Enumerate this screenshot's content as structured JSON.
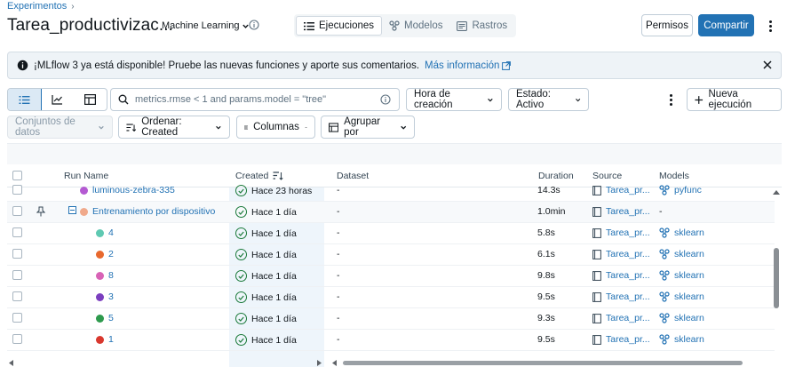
{
  "breadcrumb": {
    "root": "Experimentos",
    "sep": "›"
  },
  "experiment": {
    "title": "Tarea_productivizac...",
    "type_label": "Machine Learning"
  },
  "view_tabs": [
    {
      "label": "Ejecuciones",
      "icon": "list-icon",
      "active": true
    },
    {
      "label": "Modelos",
      "icon": "models-icon",
      "active": false
    },
    {
      "label": "Rastros",
      "icon": "traces-icon",
      "active": false
    }
  ],
  "header_buttons": {
    "permissions": "Permisos",
    "share": "Compartir"
  },
  "banner": {
    "text": "¡MLflow 3 ya está disponible! Pruebe las nuevas funciones y aporte sus comentarios.",
    "link": "Más información"
  },
  "search": {
    "placeholder": "metrics.rmse < 1 and params.model = \"tree\""
  },
  "filters": {
    "sort_time": "Hora de creación",
    "state": "Estado: Activo",
    "new_run": "Nueva ejecución"
  },
  "toolbar2": {
    "datasets": "Conjuntos de datos",
    "sort": "Ordenar: Created",
    "columns": "Columnas",
    "group": "Agrupar por"
  },
  "columns": {
    "run_name": "Run Name",
    "created": "Created",
    "dataset": "Dataset",
    "duration": "Duration",
    "source": "Source",
    "models": "Models"
  },
  "rows": [
    {
      "name": "luminous-zebra-335",
      "color": "#b45ad2",
      "created": "Hace 23 horas",
      "dataset": "-",
      "duration": "14.3s",
      "source": "Tarea_pr...",
      "model": "pyfunc"
    },
    {
      "name": "Entrenamiento por dispositivo",
      "color": "#f0a98b",
      "created": "Hace 1 día",
      "dataset": "-",
      "duration": "1.0min",
      "source": "Tarea_pr...",
      "model": "-"
    },
    {
      "name": "4",
      "color": "#5fc9b2",
      "created": "Hace 1 día",
      "dataset": "-",
      "duration": "5.8s",
      "source": "Tarea_pr...",
      "model": "sklearn"
    },
    {
      "name": "2",
      "color": "#e8692e",
      "created": "Hace 1 día",
      "dataset": "-",
      "duration": "6.1s",
      "source": "Tarea_pr...",
      "model": "sklearn"
    },
    {
      "name": "8",
      "color": "#d863b6",
      "created": "Hace 1 día",
      "dataset": "-",
      "duration": "9.8s",
      "source": "Tarea_pr...",
      "model": "sklearn"
    },
    {
      "name": "3",
      "color": "#7b3fbf",
      "created": "Hace 1 día",
      "dataset": "-",
      "duration": "9.5s",
      "source": "Tarea_pr...",
      "model": "sklearn"
    },
    {
      "name": "5",
      "color": "#2e9a4d",
      "created": "Hace 1 día",
      "dataset": "-",
      "duration": "9.3s",
      "source": "Tarea_pr...",
      "model": "sklearn"
    },
    {
      "name": "1",
      "color": "#d9382e",
      "created": "Hace 1 día",
      "dataset": "-",
      "duration": "9.5s",
      "source": "Tarea_pr...",
      "model": "sklearn"
    }
  ]
}
